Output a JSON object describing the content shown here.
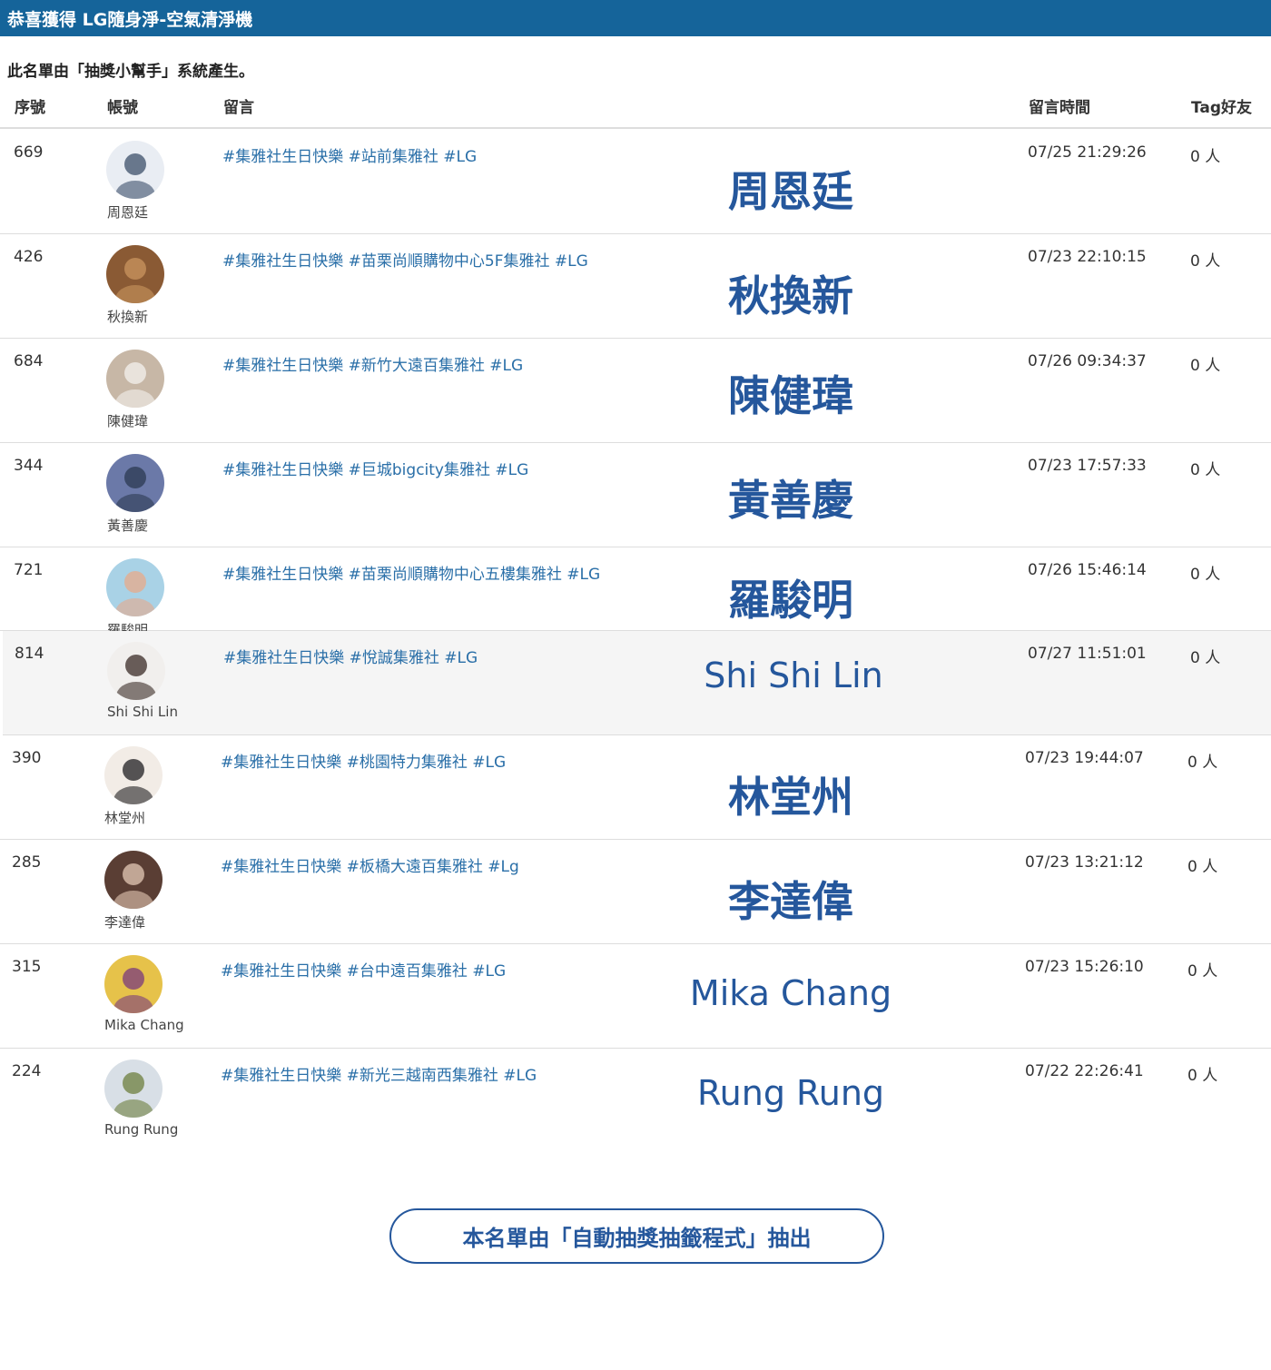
{
  "title": "恭喜獲得 LG隨身淨-空氣清淨機",
  "subtitle": "此名單由「抽獎小幫手」系統產生。",
  "columns": {
    "seq": "序號",
    "account": "帳號",
    "comment": "留言",
    "time": "留言時間",
    "tag": "Tag好友"
  },
  "winners": [
    {
      "seq": "669",
      "account": "周恩廷",
      "comment": "#集雅社生日快樂 #站前集雅社 #LG",
      "time": "07/25 21:29:26",
      "tag": "0 人",
      "name_overlay": "周恩廷",
      "avatar_colors": [
        "#e9edf3",
        "#3c4f6a"
      ]
    },
    {
      "seq": "426",
      "account": "秋換新",
      "comment": "#集雅社生日快樂 #苗栗尚順購物中心5F集雅社 #LG",
      "time": "07/23 22:10:15",
      "tag": "0 人",
      "name_overlay": "秋換新",
      "avatar_colors": [
        "#8a5a34",
        "#c9965f"
      ]
    },
    {
      "seq": "684",
      "account": "陳健瑋",
      "comment": "#集雅社生日快樂 #新竹大遠百集雅社 #LG",
      "time": "07/26 09:34:37",
      "tag": "0 人",
      "name_overlay": "陳健瑋",
      "avatar_colors": [
        "#c7b7a6",
        "#f4f2ee"
      ]
    },
    {
      "seq": "344",
      "account": "黃善慶",
      "comment": "#集雅社生日快樂 #巨城bigcity集雅社 #LG",
      "time": "07/23 17:57:33",
      "tag": "0 人",
      "name_overlay": "黃善慶",
      "avatar_colors": [
        "#6b79a8",
        "#2b3a52"
      ]
    },
    {
      "seq": "721",
      "account": "羅駿明",
      "comment": "#集雅社生日快樂 #苗栗尚順購物中心五樓集雅社 #LG",
      "time": "07/26 15:46:14",
      "tag": "0 人",
      "name_overlay": "羅駿明",
      "avatar_colors": [
        "#a9d2e6",
        "#e8a98a"
      ]
    },
    {
      "seq": "814",
      "account": "Shi Shi Lin",
      "comment": "#集雅社生日快樂 #悅誠集雅社 #LG",
      "time": "07/27 11:51:01",
      "tag": "0 人",
      "name_overlay": "Shi Shi Lin",
      "avatar_colors": [
        "#f1efed",
        "#3a2b26"
      ]
    },
    {
      "seq": "390",
      "account": "林堂州",
      "comment": "#集雅社生日快樂 #桃園特力集雅社 #LG",
      "time": "07/23 19:44:07",
      "tag": "0 人",
      "name_overlay": "林堂州",
      "avatar_colors": [
        "#f2ece6",
        "#1f1f22"
      ]
    },
    {
      "seq": "285",
      "account": "李達偉",
      "comment": "#集雅社生日快樂 #板橋大遠百集雅社 #Lg",
      "time": "07/23 13:21:12",
      "tag": "0 人",
      "name_overlay": "李達偉",
      "avatar_colors": [
        "#5a3e34",
        "#e4c9b5"
      ]
    },
    {
      "seq": "315",
      "account": "Mika Chang",
      "comment": "#集雅社生日快樂 #台中遠百集雅社 #LG",
      "time": "07/23 15:26:10",
      "tag": "0 人",
      "name_overlay": "Mika Chang",
      "avatar_colors": [
        "#e6c24a",
        "#7a3a7e"
      ]
    },
    {
      "seq": "224",
      "account": "Rung Rung",
      "comment": "#集雅社生日快樂 #新光三越南西集雅社 #LG",
      "time": "07/22 22:26:41",
      "tag": "0 人",
      "name_overlay": "Rung Rung",
      "avatar_colors": [
        "#d8dfe6",
        "#6e7f3e"
      ]
    }
  ],
  "footer_button": "本名單由「自動抽獎抽籤程式」抽出",
  "colors": {
    "topbar": "#15649a",
    "overlay": "#25579c",
    "comment_link": "#2a6fa8"
  }
}
